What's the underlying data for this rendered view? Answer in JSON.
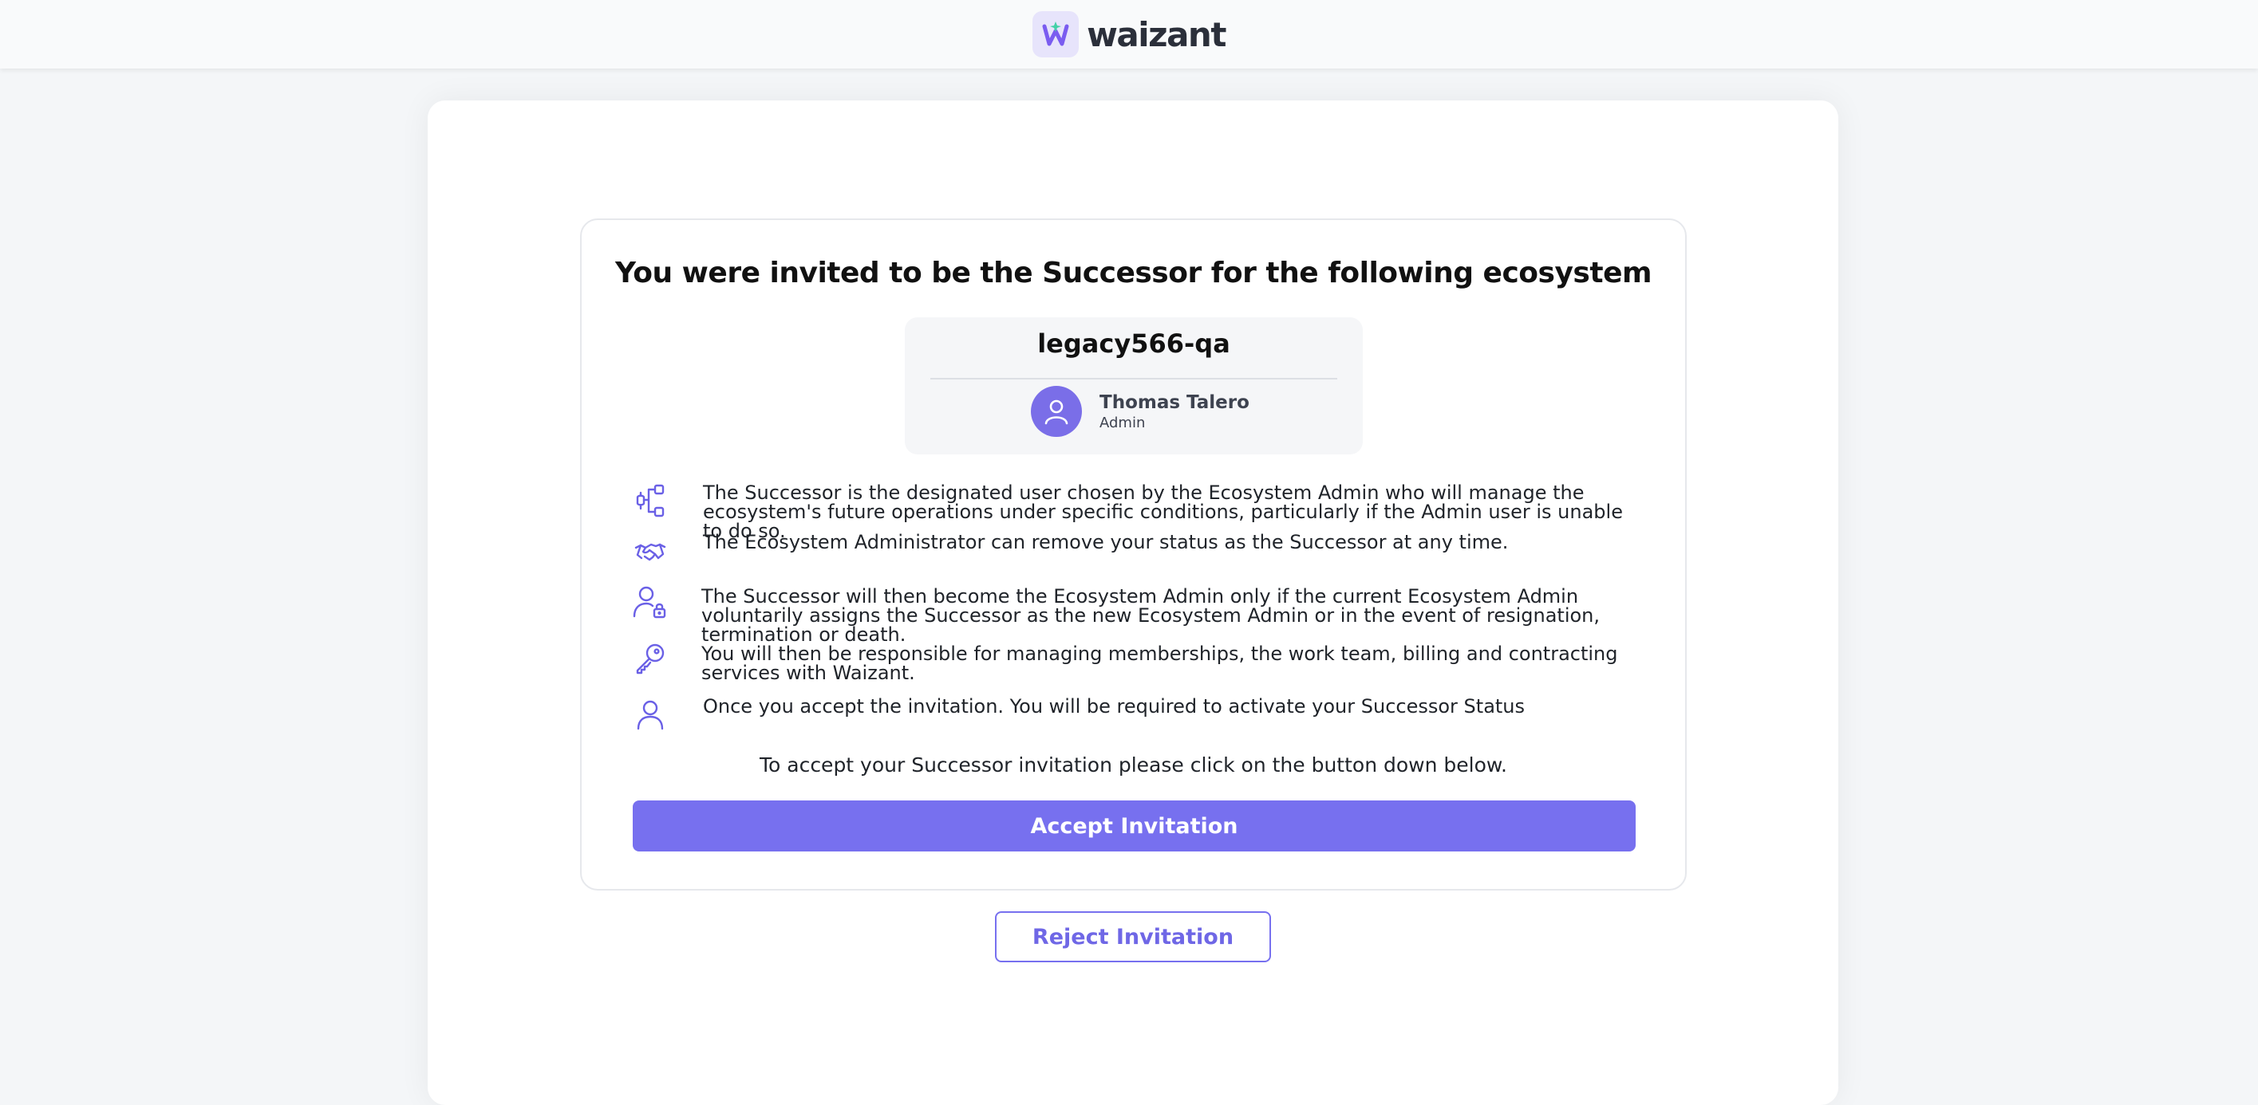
{
  "brand": {
    "name": "waizant",
    "icon": "waizant-logo-icon",
    "accent": "#7770ef"
  },
  "invitation": {
    "title": "You were invited to be the Successor for the following ecosystem",
    "ecosystem_name": "legacy566-qa",
    "owner": {
      "name": "Thomas Talero",
      "role": "Admin",
      "icon": "user-avatar-icon"
    },
    "points": [
      {
        "icon": "hierarchy-icon",
        "text": "The Successor is the designated user chosen by the Ecosystem Admin who will manage the ecosystem's future operations under specific conditions, particularly if the Admin user is unable to do so."
      },
      {
        "icon": "handshake-icon",
        "text": "The Ecosystem Administrator can remove your status as the Successor at any time."
      },
      {
        "icon": "user-lock-icon",
        "text": "The Successor will then become the Ecosystem Admin only if the current Ecosystem Admin voluntarily assigns the Successor as the new Ecosystem Admin or in the event of resignation, termination or death."
      },
      {
        "icon": "key-icon",
        "text": "You will then be responsible for managing memberships, the work team, billing and contracting services with Waizant."
      },
      {
        "icon": "user-icon",
        "text": "Once you accept the invitation. You will be required to activate your Successor Status"
      }
    ],
    "instructions": "To accept your Successor invitation please click on the button down below.",
    "accept_label": "Accept Invitation",
    "reject_label": "Reject Invitation"
  }
}
